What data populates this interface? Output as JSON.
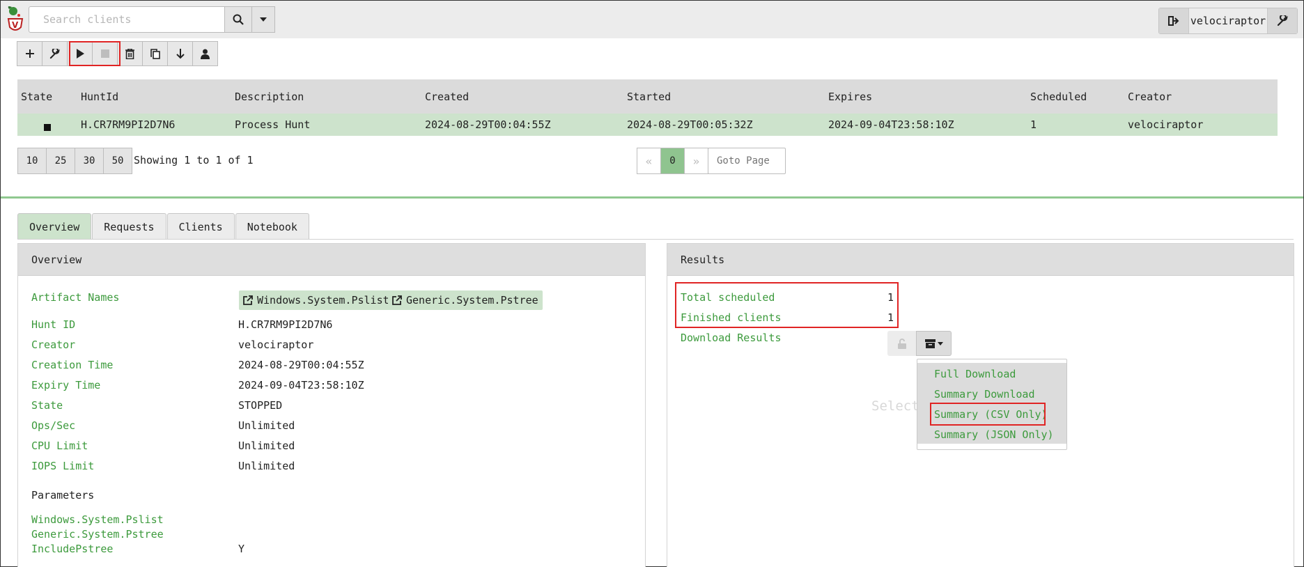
{
  "header": {
    "search_placeholder": "Search clients",
    "username": "velociraptor"
  },
  "hunts_table": {
    "columns": [
      "State",
      "HuntId",
      "Description",
      "Created",
      "Started",
      "Expires",
      "Scheduled",
      "Creator"
    ],
    "rows": [
      {
        "state_icon": "stop-square-icon",
        "hunt_id": "H.CR7RM9PI2D7N6",
        "description": "Process Hunt",
        "created": "2024-08-29T00:04:55Z",
        "started": "2024-08-29T00:05:32Z",
        "expires": "2024-09-04T23:58:10Z",
        "scheduled": "1",
        "creator": "velociraptor"
      }
    ]
  },
  "pagination": {
    "page_sizes": [
      "10",
      "25",
      "30",
      "50"
    ],
    "showing_text": "Showing 1 to 1 of 1",
    "prev": "«",
    "current_page": "0",
    "next": "»",
    "goto_placeholder": "Goto Page"
  },
  "tabs": [
    "Overview",
    "Requests",
    "Clients",
    "Notebook"
  ],
  "overview": {
    "title": "Overview",
    "artifact_names_label": "Artifact Names",
    "artifacts": [
      "Windows.System.Pslist",
      "Generic.System.Pstree"
    ],
    "fields": [
      {
        "label": "Hunt ID",
        "value": "H.CR7RM9PI2D7N6"
      },
      {
        "label": "Creator",
        "value": "velociraptor"
      },
      {
        "label": "Creation Time",
        "value": "2024-08-29T00:04:55Z"
      },
      {
        "label": "Expiry Time",
        "value": "2024-09-04T23:58:10Z"
      },
      {
        "label": "State",
        "value": "STOPPED"
      },
      {
        "label": "Ops/Sec",
        "value": "Unlimited"
      },
      {
        "label": "CPU Limit",
        "value": "Unlimited"
      },
      {
        "label": "IOPS Limit",
        "value": "Unlimited"
      }
    ],
    "parameters_title": "Parameters",
    "parameters": [
      {
        "label": "Windows.System.Pslist",
        "value": ""
      },
      {
        "label": "Generic.System.Pstree",
        "value": ""
      },
      {
        "label": "IncludePstree",
        "value": "Y"
      }
    ]
  },
  "results": {
    "title": "Results",
    "total_scheduled_label": "Total scheduled",
    "total_scheduled_value": "1",
    "finished_clients_label": "Finished clients",
    "finished_clients_value": "1",
    "download_results_label": "Download Results",
    "background_text": "Select a download method",
    "download_menu": [
      "Full Download",
      "Summary Download",
      "Summary (CSV Only)",
      "Summary (JSON Only)"
    ]
  },
  "colors": {
    "accent_green": "#3c9a3c",
    "row_highlight": "#cde3cc",
    "annotation_red": "#e02424"
  }
}
